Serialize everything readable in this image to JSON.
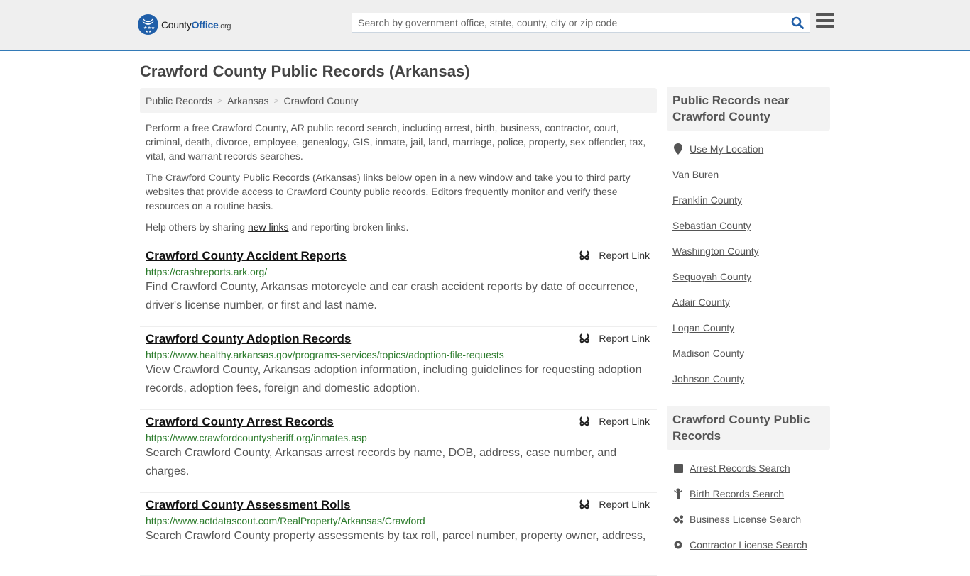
{
  "header": {
    "logo": {
      "text_main": "County",
      "text_brand": "Office",
      "text_tld": ".org",
      "icon": "eagle-stars-badge-icon"
    },
    "search": {
      "placeholder": "Search by government office, state, county, city or zip code",
      "value": "",
      "icon": "search-icon"
    },
    "menu_icon": "hamburger-menu-icon"
  },
  "colors": {
    "accent": "#337ab7",
    "brand": "#1f5ea8",
    "url_green": "#2a7a2a"
  },
  "page_title": "Crawford County Public Records (Arkansas)",
  "breadcrumb": [
    {
      "label": "Public Records"
    },
    {
      "label": "Arkansas"
    },
    {
      "label": "Crawford County"
    }
  ],
  "breadcrumb_separator": ">",
  "intro": {
    "p1": "Perform a free Crawford County, AR public record search, including arrest, birth, business, contractor, court, criminal, death, divorce, employee, genealogy, GIS, inmate, jail, land, marriage, police, property, sex offender, tax, vital, and warrant records searches.",
    "p2": "The Crawford County Public Records (Arkansas) links below open in a new window and take you to third party websites that provide access to Crawford County public records. Editors frequently monitor and verify these resources on a routine basis.",
    "p3_before": "Help others by sharing ",
    "p3_link": "new links",
    "p3_after": " and reporting broken links."
  },
  "report_link_label": "Report Link",
  "records": [
    {
      "title": "Crawford County Accident Reports",
      "url": "https://crashreports.ark.org/",
      "description": "Find Crawford County, Arkansas motorcycle and car crash accident reports by date of occurrence, driver's license number, or first and last name."
    },
    {
      "title": "Crawford County Adoption Records",
      "url": "https://www.healthy.arkansas.gov/programs-services/topics/adoption-file-requests",
      "description": "View Crawford County, Arkansas adoption information, including guidelines for requesting adoption records, adoption fees, foreign and domestic adoption."
    },
    {
      "title": "Crawford County Arrest Records",
      "url": "https://www.crawfordcountysheriff.org/inmates.asp",
      "description": "Search Crawford County, Arkansas arrest records by name, DOB, address, case number, and charges."
    },
    {
      "title": "Crawford County Assessment Rolls",
      "url": "https://www.actdatascout.com/RealProperty/Arkansas/Crawford",
      "description": "Search Crawford County property assessments by tax roll, parcel number, property owner, address,"
    }
  ],
  "sidebar": {
    "nearby": {
      "heading": "Public Records near Crawford County",
      "use_location": "Use My Location",
      "items": [
        "Van Buren",
        "Franklin County",
        "Sebastian County",
        "Washington County",
        "Sequoyah County",
        "Adair County",
        "Logan County",
        "Madison County",
        "Johnson County"
      ]
    },
    "county_records": {
      "heading": "Crawford County Public Records",
      "items": [
        {
          "label": "Arrest Records Search",
          "icon": "square-icon"
        },
        {
          "label": "Birth Records Search",
          "icon": "child-icon"
        },
        {
          "label": "Business License Search",
          "icon": "gears-icon"
        },
        {
          "label": "Contractor License Search",
          "icon": "gear-icon"
        }
      ]
    }
  }
}
